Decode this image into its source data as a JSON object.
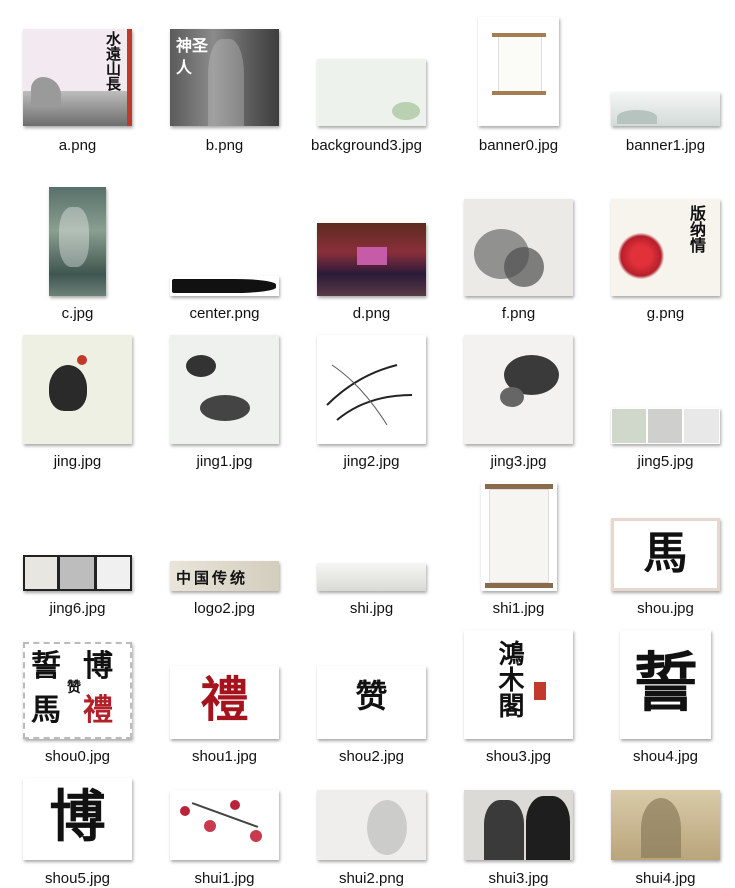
{
  "files": [
    {
      "name": "a.png"
    },
    {
      "name": "b.png"
    },
    {
      "name": "background3.jpg"
    },
    {
      "name": "banner0.jpg"
    },
    {
      "name": "banner1.jpg"
    },
    {
      "name": "c.jpg"
    },
    {
      "name": "center.png"
    },
    {
      "name": "d.png"
    },
    {
      "name": "f.png"
    },
    {
      "name": "g.png"
    },
    {
      "name": "jing.jpg"
    },
    {
      "name": "jing1.jpg"
    },
    {
      "name": "jing2.jpg"
    },
    {
      "name": "jing3.jpg"
    },
    {
      "name": "jing5.jpg"
    },
    {
      "name": "jing6.jpg"
    },
    {
      "name": "logo2.jpg"
    },
    {
      "name": "shi.jpg"
    },
    {
      "name": "shi1.jpg"
    },
    {
      "name": "shou.jpg"
    },
    {
      "name": "shou0.jpg"
    },
    {
      "name": "shou1.jpg"
    },
    {
      "name": "shou2.jpg"
    },
    {
      "name": "shou3.jpg"
    },
    {
      "name": "shou4.jpg"
    },
    {
      "name": "shou5.jpg"
    },
    {
      "name": "shui1.jpg"
    },
    {
      "name": "shui2.png"
    },
    {
      "name": "shui3.jpg"
    },
    {
      "name": "shui4.jpg"
    }
  ],
  "thumb_text": {
    "a": "水遠山長",
    "b": "神圣人",
    "g": "版纳情",
    "logo2": "中国传统",
    "shou": "馬",
    "shou0": [
      "誓",
      "博",
      "馬",
      "禮"
    ],
    "shou0_center": "赞",
    "shou1": "禮",
    "shou2": "赞",
    "shou3": "鴻木閣",
    "shou4": "誓",
    "shou5": "博"
  }
}
